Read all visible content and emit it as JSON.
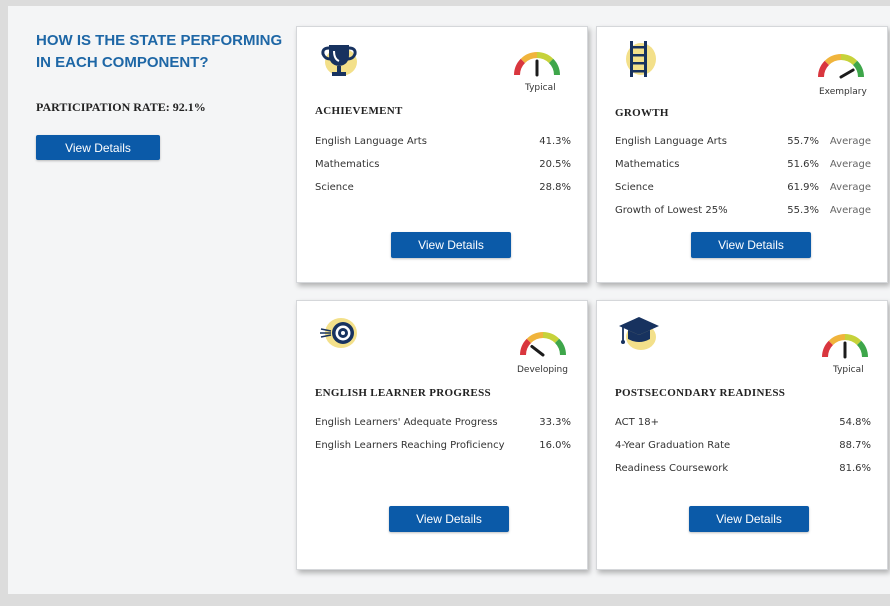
{
  "intro": {
    "title": "HOW IS THE STATE PERFORMING IN EACH COMPONENT?",
    "participation": "PARTICIPATION RATE: 92.1%",
    "button_label": "View Details"
  },
  "cards": {
    "achievement": {
      "title": "ACHIEVEMENT",
      "icon": "trophy-icon",
      "gauge": {
        "label": "Typical",
        "level": 0.5
      },
      "rows": [
        {
          "label": "English Language Arts",
          "value": "41.3%"
        },
        {
          "label": "Mathematics",
          "value": "20.5%"
        },
        {
          "label": "Science",
          "value": "28.8%"
        }
      ],
      "button_label": "View Details"
    },
    "growth": {
      "title": "GROWTH",
      "icon": "ladder-icon",
      "gauge": {
        "label": "Exemplary",
        "level": 0.9
      },
      "rows": [
        {
          "label": "English Language Arts",
          "value": "55.7%",
          "rating": "Average"
        },
        {
          "label": "Mathematics",
          "value": "51.6%",
          "rating": "Average"
        },
        {
          "label": "Science",
          "value": "61.9%",
          "rating": "Average"
        },
        {
          "label": "Growth of Lowest 25%",
          "value": "55.3%",
          "rating": "Average"
        }
      ],
      "button_label": "View Details"
    },
    "english_learner": {
      "title": "ENGLISH LEARNER PROGRESS",
      "icon": "target-icon",
      "gauge": {
        "label": "Developing",
        "level": 0.15
      },
      "rows": [
        {
          "label": "English Learners' Adequate Progress",
          "value": "33.3%"
        },
        {
          "label": "English Learners Reaching Proficiency",
          "value": "16.0%"
        }
      ],
      "button_label": "View Details"
    },
    "postsecondary": {
      "title": "POSTSECONDARY READINESS",
      "icon": "graduation-cap-icon",
      "gauge": {
        "label": "Typical",
        "level": 0.5
      },
      "rows": [
        {
          "label": "ACT 18+",
          "value": "54.8%"
        },
        {
          "label": "4-Year Graduation Rate",
          "value": "88.7%"
        },
        {
          "label": "Readiness Coursework",
          "value": "81.6%"
        }
      ],
      "button_label": "View Details"
    }
  },
  "colors": {
    "accent_blue": "#0b5aa8",
    "title_blue": "#1e67a6",
    "icon_navy": "#17325f",
    "icon_highlight": "#f3e08a"
  }
}
